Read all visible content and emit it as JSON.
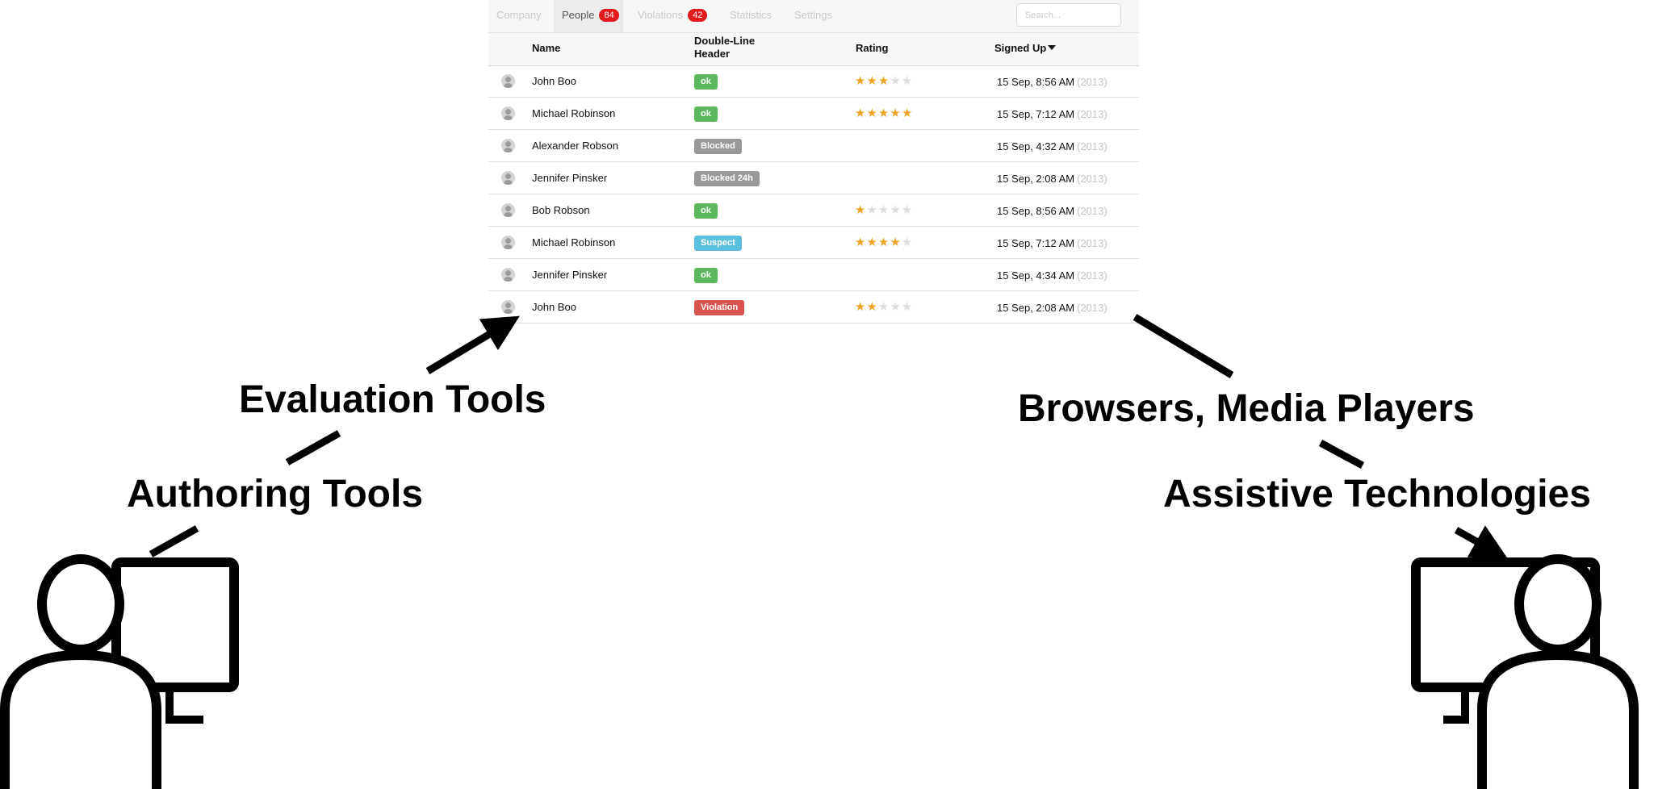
{
  "tabs": [
    {
      "label": "Company",
      "count": null,
      "active": false
    },
    {
      "label": "People",
      "count": "84",
      "active": true
    },
    {
      "label": "Violations",
      "count": "42",
      "active": false
    },
    {
      "label": "Statistics",
      "count": null,
      "active": false
    },
    {
      "label": "Settings",
      "count": null,
      "active": false
    }
  ],
  "search": {
    "placeholder": "Search..."
  },
  "table": {
    "headers": {
      "name": "Name",
      "status": "Double-Line Header",
      "rating": "Rating",
      "signed_up": "Signed Up"
    },
    "rows": [
      {
        "name": "John Boo",
        "status": "ok",
        "status_color": "#5cb85c",
        "rating": 3,
        "date": "15 Sep, 8:56 AM",
        "year": "(2013)"
      },
      {
        "name": "Michael Robinson",
        "status": "ok",
        "status_color": "#5cb85c",
        "rating": 5,
        "date": "15 Sep, 7:12 AM",
        "year": "(2013)"
      },
      {
        "name": "Alexander Robson",
        "status": "Blocked",
        "status_color": "#999999",
        "rating": null,
        "date": "15 Sep, 4:32 AM",
        "year": "(2013)"
      },
      {
        "name": "Jennifer Pinsker",
        "status": "Blocked 24h",
        "status_color": "#999999",
        "rating": null,
        "date": "15 Sep, 2:08 AM",
        "year": "(2013)"
      },
      {
        "name": "Bob Robson",
        "status": "ok",
        "status_color": "#5cb85c",
        "rating": 1,
        "date": "15 Sep, 8:56 AM",
        "year": "(2013)"
      },
      {
        "name": "Michael Robinson",
        "status": "Suspect",
        "status_color": "#5bc0de",
        "rating": 4,
        "date": "15 Sep, 7:12 AM",
        "year": "(2013)"
      },
      {
        "name": "Jennifer Pinsker",
        "status": "ok",
        "status_color": "#5cb85c",
        "rating": null,
        "date": "15 Sep, 4:34 AM",
        "year": "(2013)"
      },
      {
        "name": "John Boo",
        "status": "Violation",
        "status_color": "#d9534f",
        "rating": 2,
        "date": "15 Sep, 2:08 AM",
        "year": "(2013)"
      }
    ]
  },
  "labels": {
    "evaluation": "Evaluation Tools",
    "authoring": "Authoring Tools",
    "browsers": "Browsers, Media Players",
    "assistive": "Assistive Technologies"
  },
  "colors": {
    "star_on": "#f0a328",
    "star_off": "#dcdcdc",
    "badge_count": "#e2191d"
  }
}
